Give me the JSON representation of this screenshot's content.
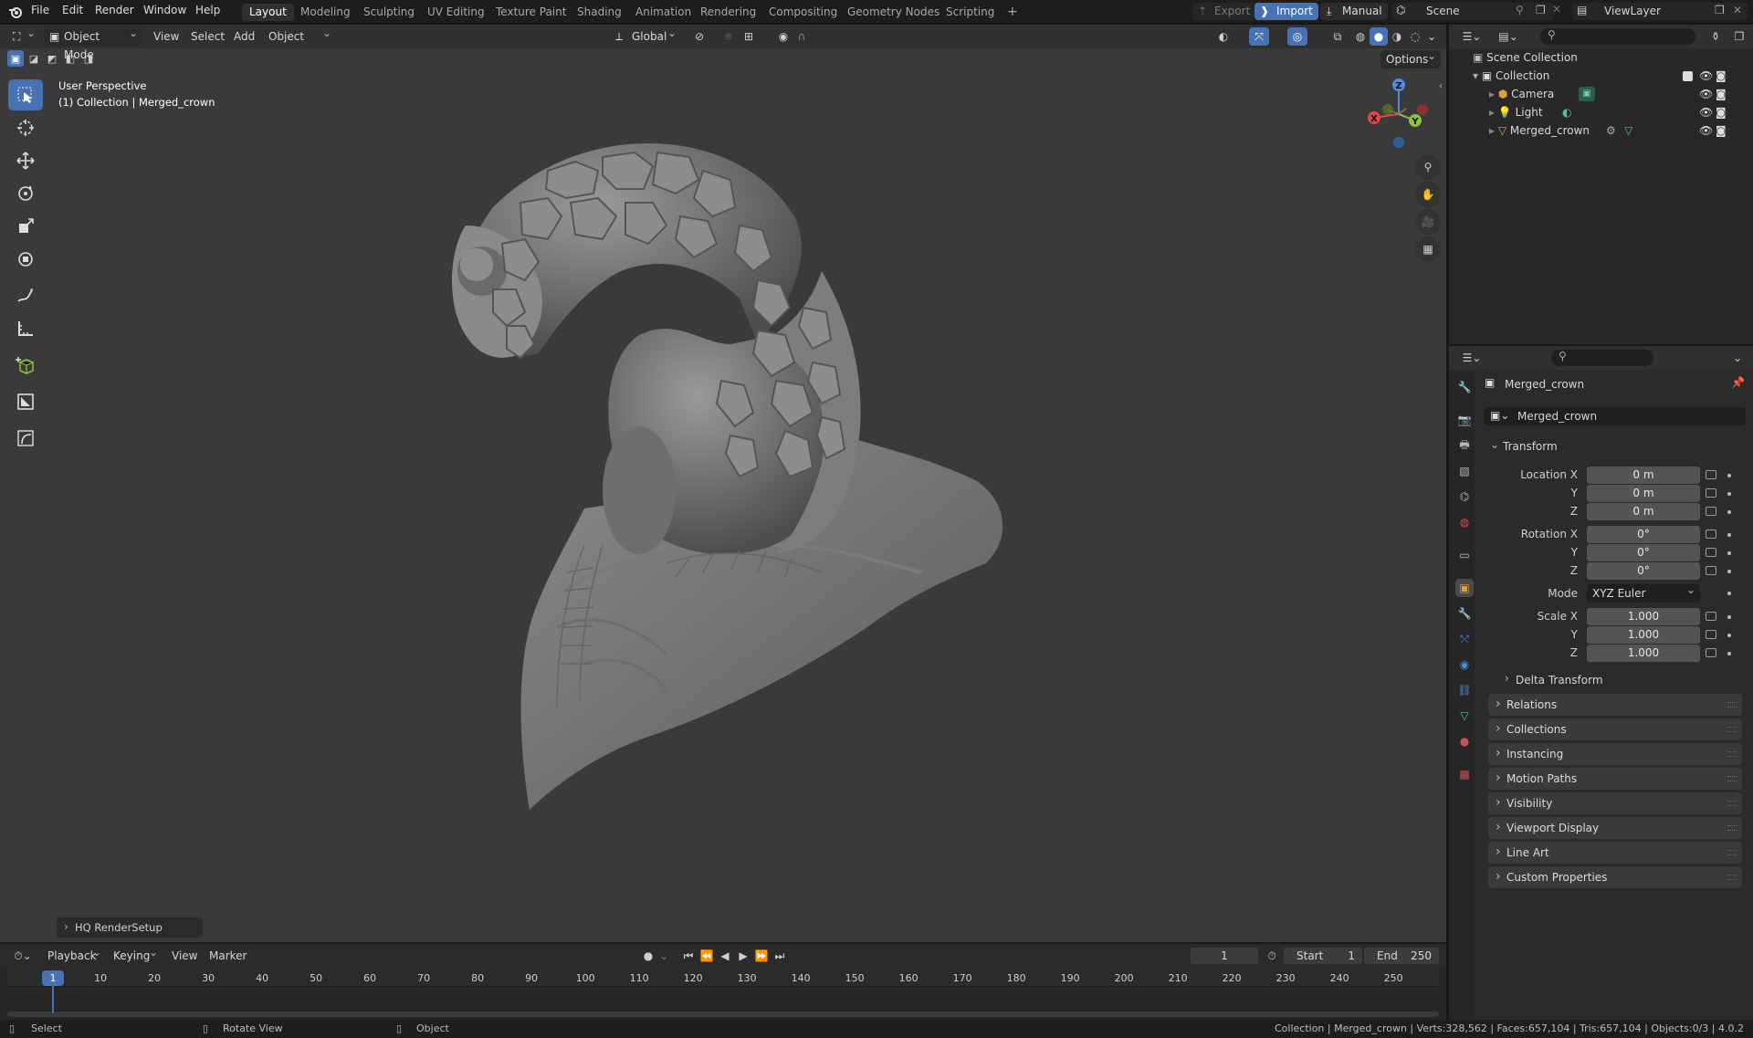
{
  "top_menu": {
    "items": [
      "File",
      "Edit",
      "Render",
      "Window",
      "Help"
    ]
  },
  "workspaces": {
    "tabs": [
      "Layout",
      "Modeling",
      "Sculpting",
      "UV Editing",
      "Texture Paint",
      "Shading",
      "Animation",
      "Rendering",
      "Compositing",
      "Geometry Nodes",
      "Scripting"
    ],
    "active": "Layout",
    "add": "+"
  },
  "top_right": {
    "export_label": "Export",
    "import_label": "Import",
    "manual_label": "Manual",
    "scene_name": "Scene",
    "view_layer_name": "ViewLayer"
  },
  "viewport_header": {
    "mode": "Object Mode",
    "menus": [
      "View",
      "Select",
      "Add",
      "Object"
    ],
    "transform_orientation": "Global",
    "options_label": "Options"
  },
  "viewport": {
    "perspective_label": "User Perspective",
    "collection_label": "(1) Collection | Merged_crown",
    "redo_panel": "HQ RenderSetup",
    "gizmo": {
      "x": "X",
      "y": "Y",
      "z": "Z"
    }
  },
  "outliner": {
    "root": "Scene Collection",
    "collection": "Collection",
    "items": [
      {
        "name": "Camera"
      },
      {
        "name": "Light"
      },
      {
        "name": "Merged_crown"
      }
    ]
  },
  "properties": {
    "object_name": "Merged_crown",
    "object_field": "Merged_crown",
    "transform_title": "Transform",
    "location": {
      "label_x": "Location X",
      "label_y": "Y",
      "label_z": "Z",
      "x": "0 m",
      "y": "0 m",
      "z": "0 m"
    },
    "rotation": {
      "label_x": "Rotation X",
      "label_y": "Y",
      "label_z": "Z",
      "x": "0°",
      "y": "0°",
      "z": "0°"
    },
    "mode": {
      "label": "Mode",
      "value": "XYZ Euler"
    },
    "scale": {
      "label_x": "Scale X",
      "label_y": "Y",
      "label_z": "Z",
      "x": "1.000",
      "y": "1.000",
      "z": "1.000"
    },
    "delta_transform": "Delta Transform",
    "sections": [
      "Relations",
      "Collections",
      "Instancing",
      "Motion Paths",
      "Visibility",
      "Viewport Display",
      "Line Art",
      "Custom Properties"
    ]
  },
  "timeline": {
    "menus": [
      "Playback",
      "Keying",
      "View",
      "Marker"
    ],
    "current_frame": "1",
    "start_label": "Start",
    "start": "1",
    "end_label": "End",
    "end": "250",
    "ticks": [
      "10",
      "20",
      "30",
      "40",
      "50",
      "60",
      "70",
      "80",
      "90",
      "100",
      "110",
      "120",
      "130",
      "140",
      "150",
      "160",
      "170",
      "180",
      "190",
      "200",
      "210",
      "220",
      "230",
      "240",
      "250"
    ],
    "playhead": "1"
  },
  "status_bar": {
    "select": "Select",
    "rotate": "Rotate View",
    "object": "Object",
    "stats": "Collection | Merged_crown | Verts:328,562 | Faces:657,104 | Tris:657,104 | Objects:0/3 | 4.0.2"
  },
  "colors": {
    "accent": "#4772b3",
    "axis_x": "#e2454b",
    "axis_y": "#8bc53f",
    "axis_z": "#4a8ee0",
    "viewport_bg": "#3a3a3a",
    "panel_bg": "#303030"
  }
}
